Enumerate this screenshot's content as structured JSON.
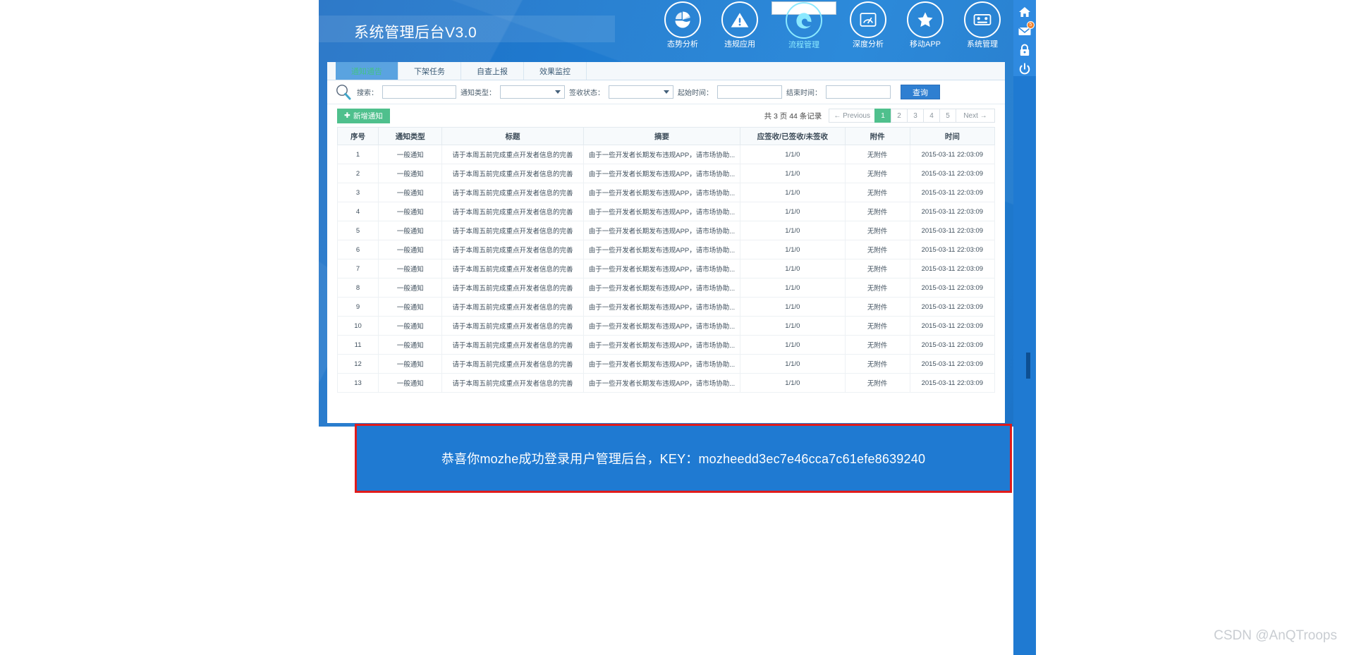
{
  "header": {
    "app_title": "系统管理后台V3.0",
    "nav_icons": [
      {
        "label": "态势分析",
        "icon": "pie-chart-icon",
        "selected": false
      },
      {
        "label": "违规应用",
        "icon": "warning-triangle-icon",
        "selected": false
      },
      {
        "label": "流程管理",
        "icon": "edge-browser-icon",
        "selected": true
      },
      {
        "label": "深度分析",
        "icon": "gauge-icon",
        "selected": false
      },
      {
        "label": "移动APP",
        "icon": "star-icon",
        "selected": false
      },
      {
        "label": "系统管理",
        "icon": "server-rack-icon",
        "selected": false
      }
    ]
  },
  "tabs": [
    {
      "label": "通知通告",
      "active": true
    },
    {
      "label": "下架任务",
      "active": false
    },
    {
      "label": "自查上报",
      "active": false
    },
    {
      "label": "效果监控",
      "active": false
    }
  ],
  "search": {
    "magnifier_icon": "search-icon",
    "keyword_label": "搜索：",
    "keyword_value": "",
    "keyword_placeholder": "",
    "type_label": "通知类型：",
    "type_value": "",
    "sign_label": "签收状态：",
    "sign_value": "",
    "start_label": "起始时间：",
    "start_value": "",
    "end_label": "结束时间：",
    "end_value": "",
    "query_button": "查询"
  },
  "actions": {
    "add_button": "新增通知",
    "add_icon": "plus-icon"
  },
  "pagination": {
    "summary": "共 3 页 44 条记录",
    "previous": "← Previous",
    "next": "Next →",
    "pages": [
      "1",
      "2",
      "3",
      "4",
      "5"
    ],
    "current": "1"
  },
  "table": {
    "columns": [
      "序号",
      "通知类型",
      "标题",
      "摘要",
      "应签收/已签收/未签收",
      "附件",
      "时间"
    ],
    "rows": [
      [
        "1",
        "一般通知",
        "请于本周五前完成重点开发者信息的完善",
        "由于一些开发者长期发布违规APP，请市场协助...",
        "1/1/0",
        "无附件",
        "2015-03-11 22:03:09"
      ],
      [
        "2",
        "一般通知",
        "请于本周五前完成重点开发者信息的完善",
        "由于一些开发者长期发布违规APP，请市场协助...",
        "1/1/0",
        "无附件",
        "2015-03-11 22:03:09"
      ],
      [
        "3",
        "一般通知",
        "请于本周五前完成重点开发者信息的完善",
        "由于一些开发者长期发布违规APP，请市场协助...",
        "1/1/0",
        "无附件",
        "2015-03-11 22:03:09"
      ],
      [
        "4",
        "一般通知",
        "请于本周五前完成重点开发者信息的完善",
        "由于一些开发者长期发布违规APP，请市场协助...",
        "1/1/0",
        "无附件",
        "2015-03-11 22:03:09"
      ],
      [
        "5",
        "一般通知",
        "请于本周五前完成重点开发者信息的完善",
        "由于一些开发者长期发布违规APP，请市场协助...",
        "1/1/0",
        "无附件",
        "2015-03-11 22:03:09"
      ],
      [
        "6",
        "一般通知",
        "请于本周五前完成重点开发者信息的完善",
        "由于一些开发者长期发布违规APP，请市场协助...",
        "1/1/0",
        "无附件",
        "2015-03-11 22:03:09"
      ],
      [
        "7",
        "一般通知",
        "请于本周五前完成重点开发者信息的完善",
        "由于一些开发者长期发布违规APP，请市场协助...",
        "1/1/0",
        "无附件",
        "2015-03-11 22:03:09"
      ],
      [
        "8",
        "一般通知",
        "请于本周五前完成重点开发者信息的完善",
        "由于一些开发者长期发布违规APP，请市场协助...",
        "1/1/0",
        "无附件",
        "2015-03-11 22:03:09"
      ],
      [
        "9",
        "一般通知",
        "请于本周五前完成重点开发者信息的完善",
        "由于一些开发者长期发布违规APP，请市场协助...",
        "1/1/0",
        "无附件",
        "2015-03-11 22:03:09"
      ],
      [
        "10",
        "一般通知",
        "请于本周五前完成重点开发者信息的完善",
        "由于一些开发者长期发布违规APP，请市场协助...",
        "1/1/0",
        "无附件",
        "2015-03-11 22:03:09"
      ],
      [
        "11",
        "一般通知",
        "请于本周五前完成重点开发者信息的完善",
        "由于一些开发者长期发布违规APP，请市场协助...",
        "1/1/0",
        "无附件",
        "2015-03-11 22:03:09"
      ],
      [
        "12",
        "一般通知",
        "请于本周五前完成重点开发者信息的完善",
        "由于一些开发者长期发布违规APP，请市场协助...",
        "1/1/0",
        "无附件",
        "2015-03-11 22:03:09"
      ],
      [
        "13",
        "一般通知",
        "请于本周五前完成重点开发者信息的完善",
        "由于一些开发者长期发布违规APP，请市场协助...",
        "1/1/0",
        "无附件",
        "2015-03-11 22:03:09"
      ]
    ]
  },
  "rail": {
    "icons": [
      {
        "name": "home-icon",
        "badge": ""
      },
      {
        "name": "mail-icon",
        "badge": "5"
      },
      {
        "name": "lock-icon",
        "badge": ""
      },
      {
        "name": "power-icon",
        "badge": ""
      }
    ]
  },
  "key_banner": {
    "text": "恭喜你mozhe成功登录用户管理后台，KEY：mozheedd3ec7e46cca7c61efe8639240",
    "border_color": "#e01b1b",
    "background_color": "#1f7ad2"
  },
  "watermark": "CSDN @AnQTroops"
}
